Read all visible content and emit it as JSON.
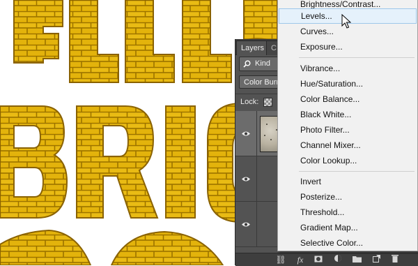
{
  "canvas": {
    "brick_color": "#d9a400",
    "mortar_color": "#a67b00",
    "letters": [
      "E",
      "L",
      "L",
      "B",
      "R",
      "I",
      "O"
    ]
  },
  "layers_panel": {
    "tabs": [
      "Layers",
      "C"
    ],
    "filter_label": "Kind",
    "blend_mode": "Color Burn",
    "lock_label": "Lock:"
  },
  "adjustment_menu": {
    "items": [
      "Brightness/Contrast...",
      "Levels...",
      "Curves...",
      "Exposure...",
      "Vibrance...",
      "Hue/Saturation...",
      "Color Balance...",
      "Black  White...",
      "Photo Filter...",
      "Channel Mixer...",
      "Color Lookup...",
      "Invert",
      "Posterize...",
      "Threshold...",
      "Gradient Map...",
      "Selective Color..."
    ],
    "hovered_item": "Levels..."
  },
  "footer_icons": [
    "link-icon",
    "fx-icon",
    "mask-icon",
    "adjustment-icon",
    "folder-icon",
    "new-layer-icon",
    "trash-icon"
  ],
  "colors": {
    "panel_bg": "#535353",
    "menu_bg": "#f1f1f1",
    "menu_hover": "#e5f1fb"
  }
}
